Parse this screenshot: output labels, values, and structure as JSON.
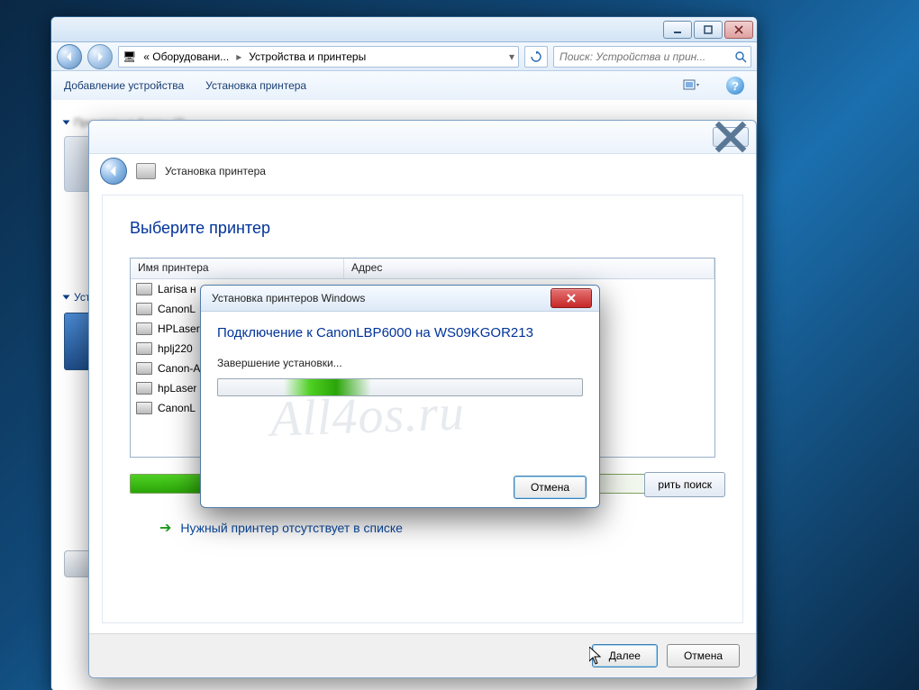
{
  "watermark": "All4os.ru",
  "outer": {
    "breadcrumb": {
      "seg1": "« Оборудовани...",
      "seg2": "Устройства и принтеры"
    },
    "search_placeholder": "Поиск: Устройства и прин...",
    "cmd_add_device": "Добавление устройства",
    "cmd_add_printer": "Установка принтера",
    "group_printers": "Принтеры и факсы (2)",
    "group_devices": "Устройства"
  },
  "wizard": {
    "header": "Установка принтера",
    "h1": "Выберите принтер",
    "col_name": "Имя принтера",
    "col_addr": "Адрес",
    "rows": [
      "Larisa н",
      "CanonL",
      "HPLaser",
      "hplj220",
      "Canon-A",
      "hpLaser",
      "CanonL"
    ],
    "search_again": "рить поиск",
    "missing": "Нужный принтер отсутствует в списке",
    "btn_next": "Далее",
    "btn_cancel": "Отмена"
  },
  "dialog": {
    "title": "Установка принтеров Windows",
    "heading": "Подключение к CanonLBP6000 на WS09KGOR213",
    "status": "Завершение установки...",
    "btn_cancel": "Отмена"
  }
}
